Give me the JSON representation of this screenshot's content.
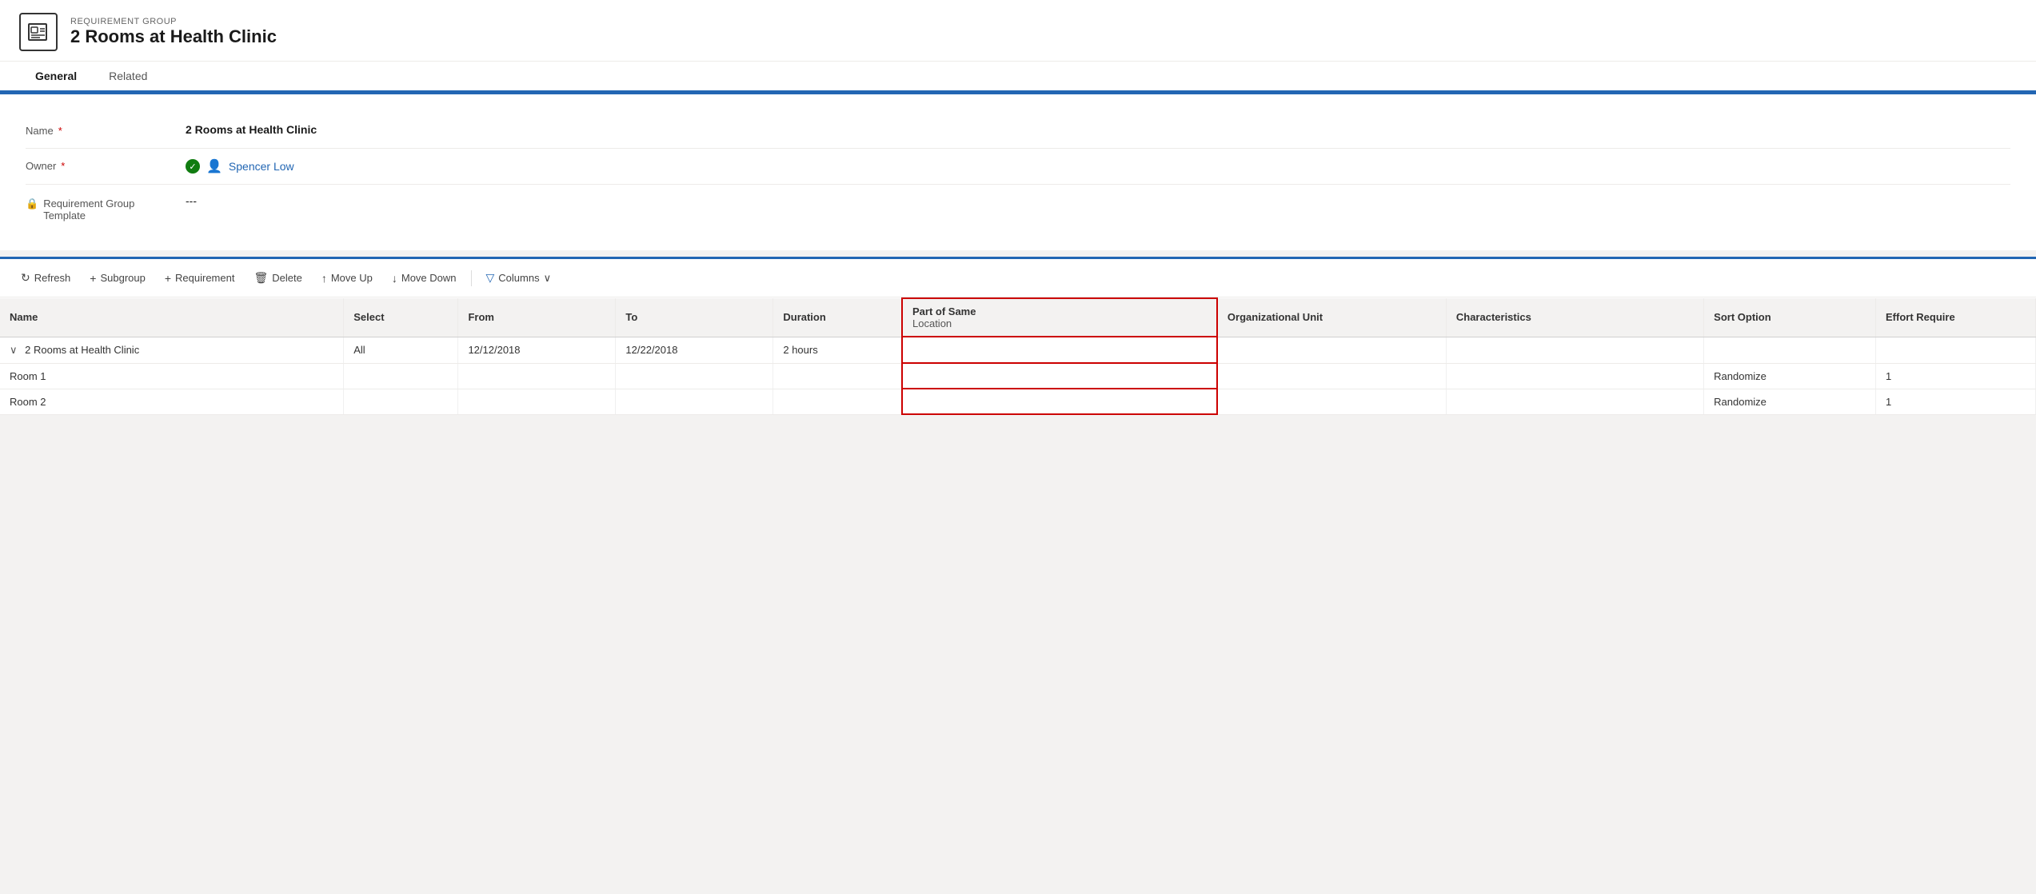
{
  "header": {
    "subtitle": "REQUIREMENT GROUP",
    "title": "2 Rooms at Health Clinic",
    "icon_label": "requirement-group-icon"
  },
  "tabs": [
    {
      "label": "General",
      "active": true
    },
    {
      "label": "Related",
      "active": false
    }
  ],
  "form": {
    "fields": [
      {
        "label": "Name",
        "required": true,
        "value": "2 Rooms at Health Clinic",
        "type": "text"
      },
      {
        "label": "Owner",
        "required": true,
        "value": "Spencer Low",
        "type": "user"
      },
      {
        "label": "Requirement Group Template",
        "required": false,
        "value": "---",
        "type": "locked"
      }
    ]
  },
  "toolbar": {
    "refresh_label": "Refresh",
    "subgroup_label": "Subgroup",
    "requirement_label": "Requirement",
    "delete_label": "Delete",
    "moveup_label": "Move Up",
    "movedown_label": "Move Down",
    "columns_label": "Columns"
  },
  "grid": {
    "columns": [
      {
        "key": "name",
        "label": "Name"
      },
      {
        "key": "select",
        "label": "Select"
      },
      {
        "key": "from",
        "label": "From"
      },
      {
        "key": "to",
        "label": "To"
      },
      {
        "key": "duration",
        "label": "Duration"
      },
      {
        "key": "partsame",
        "label": "Part of Same",
        "subheader": "Location",
        "highlighted": true
      },
      {
        "key": "orgunit",
        "label": "Organizational Unit"
      },
      {
        "key": "characteristics",
        "label": "Characteristics"
      },
      {
        "key": "sort",
        "label": "Sort Option"
      },
      {
        "key": "effort",
        "label": "Effort Require"
      }
    ],
    "rows": [
      {
        "name": "2 Rooms at Health Clinic",
        "expanded": true,
        "select": "All",
        "from": "12/12/2018",
        "to": "12/22/2018",
        "duration": "2 hours",
        "partsame": "",
        "orgunit": "",
        "characteristics": "",
        "sort": "",
        "effort": ""
      },
      {
        "name": "Room 1",
        "indent": true,
        "select": "",
        "from": "",
        "to": "",
        "duration": "",
        "partsame": "",
        "orgunit": "",
        "characteristics": "",
        "sort": "Randomize",
        "effort": "1"
      },
      {
        "name": "Room 2",
        "indent": true,
        "select": "",
        "from": "",
        "to": "",
        "duration": "",
        "partsame": "",
        "orgunit": "",
        "characteristics": "",
        "sort": "Randomize",
        "effort": "1"
      }
    ]
  }
}
